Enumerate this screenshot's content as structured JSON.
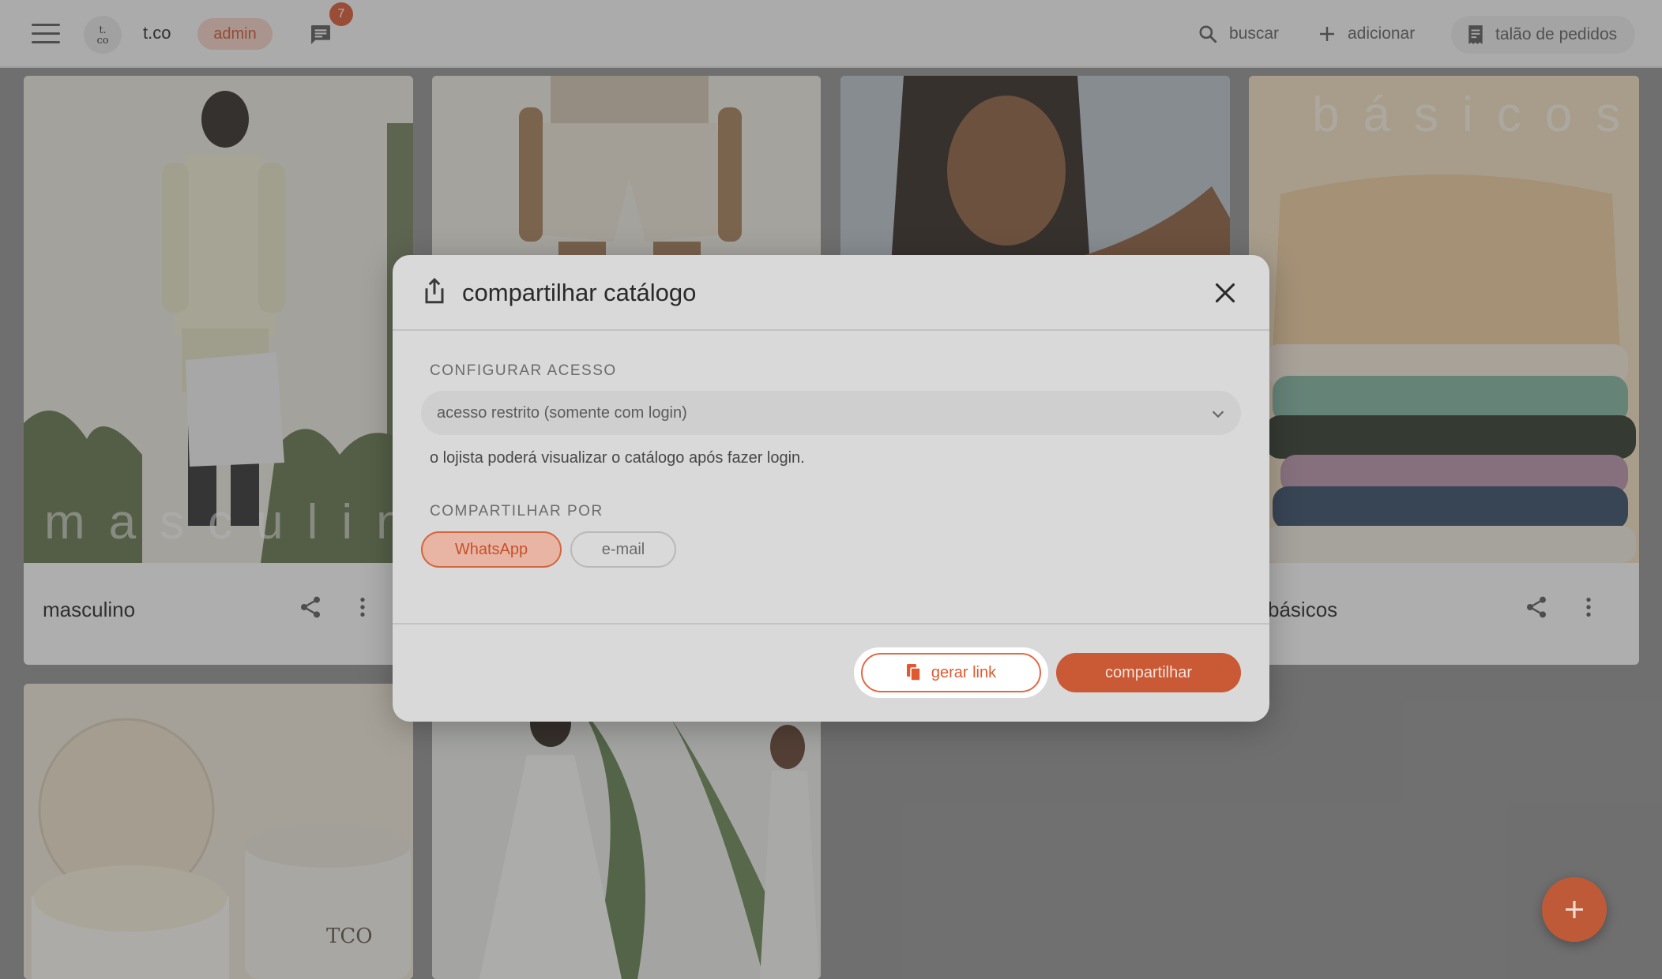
{
  "topbar": {
    "logo_text_line1": "t.",
    "logo_text_line2": "co",
    "store_name": "t.co",
    "role_badge": "admin",
    "message_count": "7",
    "search_label": "buscar",
    "add_label": "adicionar",
    "orders_label": "talão de pedidos",
    "icons": [
      "menu-icon",
      "chat-icon",
      "search-icon",
      "plus-icon",
      "receipt-icon"
    ]
  },
  "cards": [
    {
      "title": "masculino",
      "image_text": "masculino",
      "actions": [
        "share-icon",
        "more-vertical-icon"
      ]
    },
    {
      "title": "",
      "image_text": ""
    },
    {
      "title": "",
      "image_text": ""
    },
    {
      "title": "básicos",
      "image_text": "básicos",
      "actions": [
        "share-icon",
        "more-vertical-icon"
      ]
    },
    {
      "title": "",
      "image_text": "TCO"
    },
    {
      "title": "",
      "image_text": ""
    }
  ],
  "modal": {
    "title": "compartilhar catálogo",
    "access_section_label": "CONFIGURAR ACESSO",
    "access_select_value": "acesso restrito (somente com login)",
    "access_helper": "o lojista poderá visualizar o catálogo após fazer login.",
    "share_section_label": "COMPARTILHAR POR",
    "share_options": [
      {
        "label": "WhatsApp",
        "selected": true
      },
      {
        "label": "e-mail",
        "selected": false
      }
    ],
    "generate_link_label": "gerar link",
    "share_button_label": "compartilhar"
  },
  "colors": {
    "accent": "#d6532d",
    "accent_dark": "#c95a35",
    "topbar_bg": "#f4f4f4",
    "modal_bg": "#d9d9d9"
  }
}
